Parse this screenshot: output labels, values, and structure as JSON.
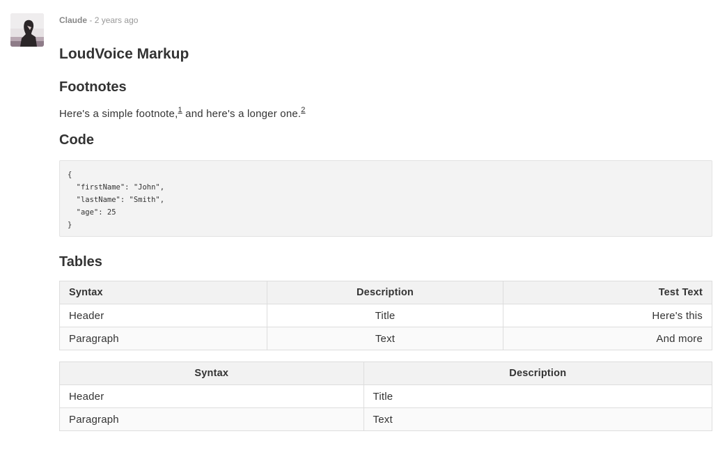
{
  "comment": {
    "author": "Claude",
    "separator": "-",
    "time": "2 years ago"
  },
  "post": {
    "title": "LoudVoice Markup",
    "footnotes": {
      "heading": "Footnotes",
      "text_before": "Here's a simple footnote,",
      "ref1": "1",
      "text_middle": " and here's a longer one.",
      "ref2": "2"
    },
    "code": {
      "heading": "Code",
      "content": "{\n  \"firstName\": \"John\",\n  \"lastName\": \"Smith\",\n  \"age\": 25\n}"
    },
    "tables": {
      "heading": "Tables",
      "table1": {
        "headers": [
          "Syntax",
          "Description",
          "Test Text"
        ],
        "rows": [
          [
            "Header",
            "Title",
            "Here's this"
          ],
          [
            "Paragraph",
            "Text",
            "And more"
          ]
        ]
      },
      "table2": {
        "headers": [
          "Syntax",
          "Description"
        ],
        "rows": [
          [
            "Header",
            "Title"
          ],
          [
            "Paragraph",
            "Text"
          ]
        ]
      }
    }
  }
}
